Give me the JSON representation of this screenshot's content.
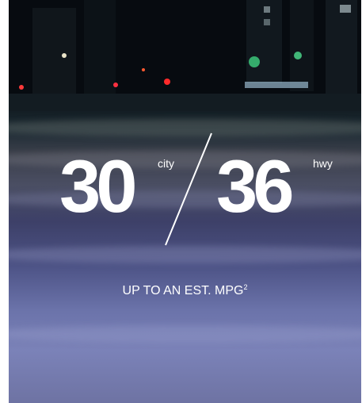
{
  "mpg": {
    "city_value": "30",
    "city_label": "city",
    "hwy_value": "36",
    "hwy_label": "hwy",
    "caption": "UP TO AN EST. MPG",
    "footnote": "2"
  },
  "colors": {
    "text": "#ffffff",
    "accent_strip": "#0b4fd0"
  }
}
